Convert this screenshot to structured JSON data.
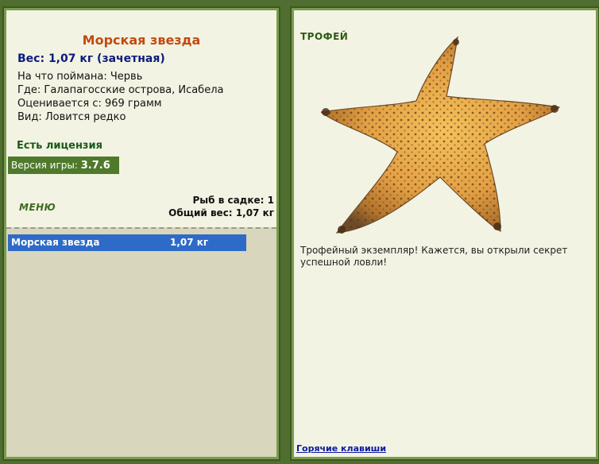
{
  "fish": {
    "name": "Морская звезда",
    "weight_line": "Вес: 1,07 кг (зачетная)",
    "bait_line": "На что поймана: Червь",
    "location_line": "Где: Галапагосские острова, Исабела",
    "valued_line": "Оценивается с: 969 грамм",
    "species_line": "Вид: Ловится редко"
  },
  "license": "Есть лицензия",
  "version": {
    "label": "Версия игры:",
    "value": "3.7.6"
  },
  "menu_label": "МЕНЮ",
  "stats": {
    "count_line": "Рыб в садке: 1",
    "total_line": "Общий вес: 1,07 кг"
  },
  "catch_list": [
    {
      "name": "Морская звезда",
      "weight": "1,07 кг"
    }
  ],
  "trophy": {
    "label": "ТРОФЕЙ",
    "text": "Трофейный экземпляр! Кажется, вы открыли секрет успешной ловли!"
  },
  "hotkeys_link": "Горячие клавиши",
  "colors": {
    "background": "#4f6e2f",
    "panel": "#f3f3e3",
    "title": "#c24a10",
    "weight": "#0c1b7c",
    "selection": "#2e6ac7",
    "link": "#0b1aa0"
  }
}
